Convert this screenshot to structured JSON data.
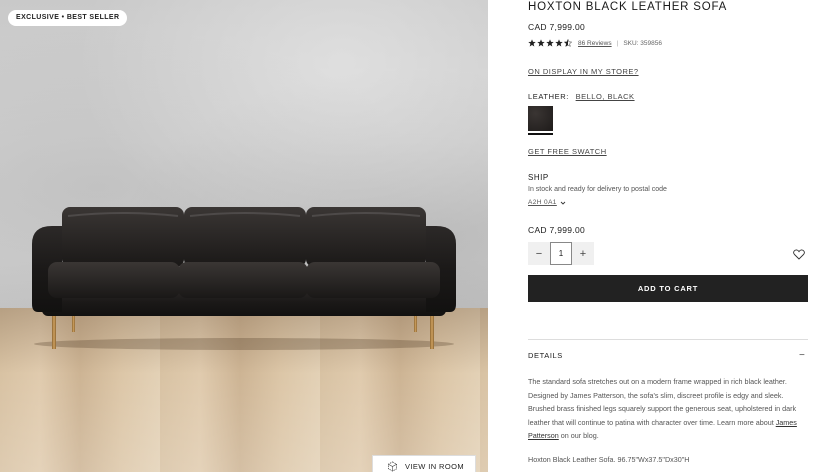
{
  "gallery": {
    "badge": "EXCLUSIVE • BEST SELLER",
    "view_in_room": "VIEW IN ROOM",
    "image_alt_icon": "sofa-photo"
  },
  "product": {
    "title": "HOXTON BLACK LEATHER SOFA",
    "price": "CAD 7,999.00",
    "rating": {
      "stars": 4.5,
      "out_of": 5,
      "reviews": "86 Reviews",
      "sku": "SKU: 359856"
    },
    "on_display": "ON DISPLAY IN MY STORE?",
    "leather_label": "LEATHER:",
    "leather_value": "BELLO, BLACK",
    "swatch_color": "#2a2625",
    "free_swatch": "GET FREE SWATCH",
    "ship_label": "SHIP",
    "ship_text": "In stock and ready for delivery to postal code",
    "postal_code": "A2H 0A1",
    "price_again": "CAD 7,999.00",
    "quantity": {
      "value": "1",
      "minus": "−",
      "plus": "+"
    },
    "add_to_cart": "ADD TO CART",
    "details": {
      "heading": "DETAILS",
      "toggle": "−",
      "body_before_link": "The standard sofa stretches out on a modern frame wrapped in rich black leather. Designed by James Patterson, the sofa's slim, discreet profile is edgy and sleek. Brushed brass finished legs squarely support the generous seat, upholstered in dark leather that will continue to patina with character over time. Learn more about ",
      "body_link": "James Patterson",
      "body_after_link": " on our blog.",
      "dims": "Hoxton Black Leather Sofa. 96.75\"Wx37.5\"Dx30\"H"
    }
  },
  "colors": {
    "button_dark": "#222222",
    "leather": "#1f1c1b",
    "brass": "#b8894a"
  }
}
